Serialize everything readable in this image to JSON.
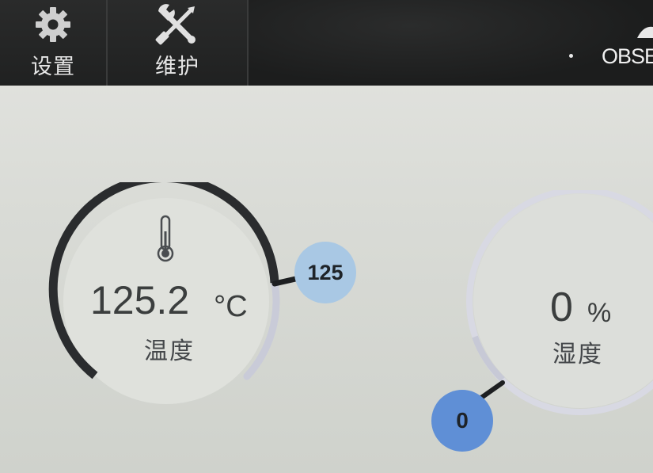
{
  "toolbar": {
    "settings": {
      "label": "设置",
      "icon": "gear-icon"
    },
    "maintenance": {
      "label": "维护",
      "icon": "wrench-screwdriver-icon"
    },
    "status_text": "OBSE"
  },
  "temperature_gauge": {
    "value": "125.2",
    "unit": "°C",
    "caption": "温度",
    "setpoint": "125",
    "icon": "thermometer-icon",
    "colors": {
      "arc": "#2a2c2e",
      "track": "#c9cbd8",
      "knob": "#a9c8e4"
    }
  },
  "humidity_gauge": {
    "value": "0",
    "unit": "%",
    "caption": "湿度",
    "setpoint": "0",
    "colors": {
      "track": "#d8d9e3",
      "knob": "#5f8fd6"
    }
  }
}
